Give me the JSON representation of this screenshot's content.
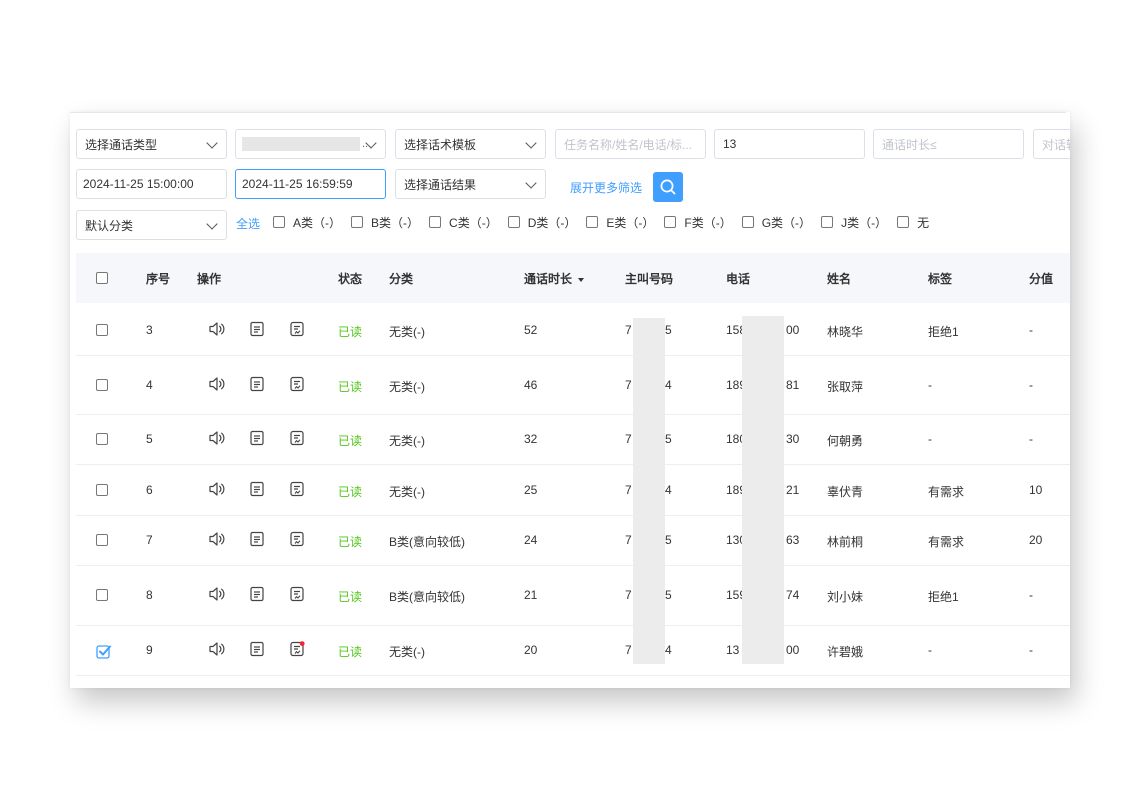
{
  "filters": {
    "call_type": "选择通话类型",
    "template": "选择话术模板",
    "task_search_placeholder": "任务名称/姓名/电话/标...",
    "value13": "13",
    "duration_placeholder": "通话时长≤",
    "dialog_placeholder": "对话轮",
    "start_time": "2024-11-25 15:00:00",
    "end_time": "2024-11-25 16:59:59",
    "call_result": "选择通话结果",
    "expand_more": "展开更多筛选",
    "default_category": "默认分类",
    "masked_dots": "..."
  },
  "categories": {
    "select_all": "全选",
    "items": [
      "A类（-）",
      "B类（-）",
      "C类（-）",
      "D类（-）",
      "E类（-）",
      "F类（-）",
      "G类（-）",
      "J类（-）",
      "无"
    ]
  },
  "table": {
    "headers": {
      "seq": "序号",
      "ops": "操作",
      "status": "状态",
      "category": "分类",
      "duration": "通话时长",
      "caller": "主叫号码",
      "phone": "电话",
      "name": "姓名",
      "tag": "标签",
      "score": "分值"
    },
    "rows": [
      {
        "seq": "3",
        "status": "已读",
        "category": "无类(-)",
        "duration": "52",
        "caller_a": "7",
        "caller_b": "5",
        "phone_a": "158",
        "phone_b": "00",
        "name": "林晓华",
        "tag": "拒绝1",
        "score": "-",
        "checked": false
      },
      {
        "seq": "4",
        "status": "已读",
        "category": "无类(-)",
        "duration": "46",
        "caller_a": "7",
        "caller_b": "4",
        "phone_a": "189",
        "phone_b": "81",
        "name": "张取萍",
        "tag": "-",
        "score": "-",
        "checked": false
      },
      {
        "seq": "5",
        "status": "已读",
        "category": "无类(-)",
        "duration": "32",
        "caller_a": "7",
        "caller_b": "5",
        "phone_a": "180",
        "phone_b": "30",
        "name": "何朝勇",
        "tag": "-",
        "score": "-",
        "checked": false
      },
      {
        "seq": "6",
        "status": "已读",
        "category": "无类(-)",
        "duration": "25",
        "caller_a": "7",
        "caller_b": "4",
        "phone_a": "189",
        "phone_b": "21",
        "name": "辜伏青",
        "tag": "有需求",
        "score": "10",
        "checked": false
      },
      {
        "seq": "7",
        "status": "已读",
        "category": "B类(意向较低)",
        "duration": "24",
        "caller_a": "7",
        "caller_b": "5",
        "phone_a": "130",
        "phone_b": "63",
        "name": "林前桐",
        "tag": "有需求",
        "score": "20",
        "checked": false
      },
      {
        "seq": "8",
        "status": "已读",
        "category": "B类(意向较低)",
        "duration": "21",
        "caller_a": "7",
        "caller_b": "5",
        "phone_a": "159",
        "phone_b": "74",
        "name": "刘小妹",
        "tag": "拒绝1",
        "score": "-",
        "checked": false
      },
      {
        "seq": "9",
        "status": "已读",
        "category": "无类(-)",
        "duration": "20",
        "caller_a": "7",
        "caller_b": "4",
        "phone_a": "13",
        "phone_b": "00",
        "name": "许碧娥",
        "tag": "-",
        "score": "-",
        "checked": true
      }
    ]
  },
  "colors": {
    "accent": "#409eff",
    "read_status": "#52c41a",
    "header_bg": "#f5f7fa",
    "notification_dot": "#f5222d"
  },
  "icons": {
    "speaker": "speaker-icon",
    "doc": "document-icon",
    "note": "edit-note-icon",
    "search": "search-icon"
  }
}
